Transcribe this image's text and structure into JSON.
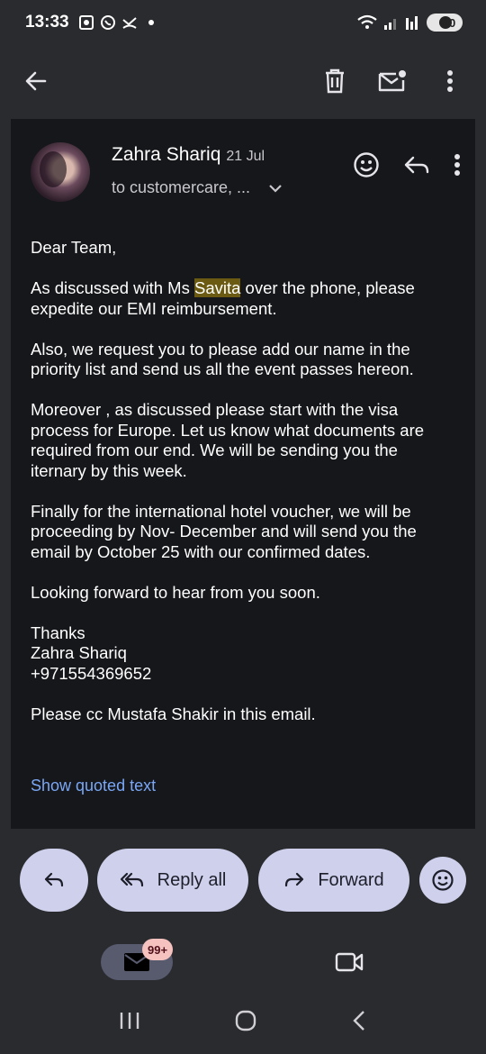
{
  "status_bar": {
    "time": "13:33",
    "battery": "60"
  },
  "app_bar": {
    "icons": [
      "back-arrow-icon",
      "delete-icon",
      "mark-unread-icon",
      "more-vert-icon"
    ]
  },
  "message": {
    "sender": "Zahra Shariq",
    "date": "21 Jul",
    "recipient": "to customercare, ...",
    "greeting": "Dear Team,",
    "p1_before": "As discussed with Ms ",
    "p1_highlight": "Savita",
    "p1_after": " over the phone, please expedite our EMI reimbursement.",
    "p2": "Also, we request you to please add our name in the priority list and send us all the event passes hereon.",
    "p3": "Moreover , as discussed please start with the visa process for Europe. Let us know what documents are required from our end. We will be sending you the iternary by this week.",
    "p4": "Finally for the international hotel voucher, we will be proceeding by Nov- December and will send you the email by October 25 with our confirmed dates.",
    "p5": "Looking forward to hear from you soon.",
    "sign_thanks": "Thanks",
    "sign_name": "Zahra Shariq",
    "sign_phone": "+971554369652",
    "p6": "Please cc Mustafa Shakir in this email.",
    "show_quoted": "Show quoted text"
  },
  "actions": {
    "reply_all": "Reply all",
    "forward": "Forward"
  },
  "bottom_nav": {
    "mail_badge": "99+"
  },
  "colors": {
    "card_bg": "#16171b",
    "page_bg": "#2a2b2f",
    "pill_bg": "#cfd1ec",
    "link": "#7aa7f5",
    "highlight": "#6b5a12"
  }
}
